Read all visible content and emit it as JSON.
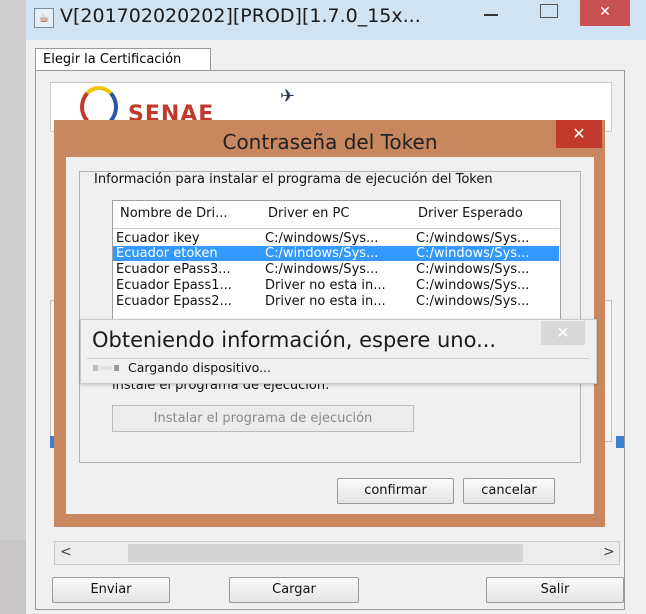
{
  "window": {
    "title": "V[201702020202][PROD][1.7.0_15x...",
    "icon": "java-app-icon",
    "minimize_label": "—",
    "close_label": "✕"
  },
  "tab": {
    "label": "Elegir la Certificación"
  },
  "logo": {
    "text": "SENAE"
  },
  "footer": {
    "enviar_label": "Enviar",
    "cargar_label": "Cargar",
    "salir_label": "Salir"
  },
  "scroll": {
    "left_arrow": "<",
    "right_arrow": ">"
  },
  "dialog": {
    "title": "Contraseña del Token",
    "close_label": "✕",
    "group_label": "Información para instalar el programa de ejecución del Token",
    "table": {
      "columns": [
        "Nombre de Dri...",
        "Driver en PC",
        "Driver Esperado"
      ],
      "rows": [
        [
          "Ecuador ikey",
          "C:/windows/Sys...",
          "C:/windows/Sys..."
        ],
        [
          "Ecuador etoken",
          "C:/windows/Sys...",
          "C:/windows/Sys..."
        ],
        [
          "Ecuador ePass3...",
          "C:/windows/Sys...",
          "C:/windows/Sys..."
        ],
        [
          "Ecuador Epass1...",
          "Driver no esta in...",
          "C:/windows/Sys..."
        ],
        [
          "Ecuador Epass2...",
          "Driver no esta in...",
          "C:/windows/Sys..."
        ]
      ],
      "selected_row": 1
    },
    "install_text": "instale el programa de ejecución.",
    "install_button": "Instalar el programa de ejecución",
    "confirm_label": "confirmar",
    "cancel_label": "cancelar"
  },
  "progress_popup": {
    "title": "Obteniendo información, espere uno...",
    "status": "Cargando dispositivo...",
    "close_label": "✕"
  }
}
